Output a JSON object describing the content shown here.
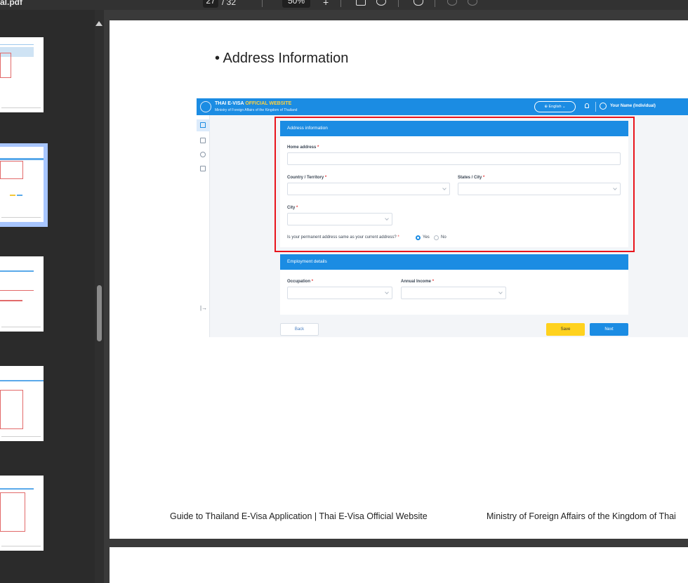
{
  "toolbar": {
    "file_name": "al.pdf",
    "current_page": "27",
    "total_pages": "/ 32",
    "zoom": "50%",
    "zoom_in": "+"
  },
  "document": {
    "section_heading": "• Address Information",
    "footer_left": "Guide to Thailand E-Visa Application | Thai E-Visa Official Website",
    "footer_right": "Ministry of Foreign Affairs of the Kingdom of Thai"
  },
  "screenshot": {
    "site_title_main": "THAI E-VISA ",
    "site_title_highlight": "OFFICIAL WEBSITE",
    "site_subtitle": "Ministry of Foreign Affairs of the Kingdom of Thailand",
    "language_button": "⊕ English ⌄",
    "user_name": "Your Name  (Individual)",
    "address_card": {
      "title": "Address information",
      "home_address_label": "Home address",
      "country_label": "Country / Territory",
      "states_label": "States / City",
      "city_label": "City",
      "permanent_question": "Is your permanent address same as your current address?",
      "required_mark": "*",
      "yes_label": "Yes",
      "no_label": "No",
      "selected_option": "Yes"
    },
    "employment_card": {
      "title": "Employment details",
      "occupation_label": "Occupation",
      "income_label": "Annual Income"
    },
    "buttons": {
      "back": "Back",
      "save": "Save",
      "next": "Next"
    },
    "logout_glyph": "|→",
    "colors": {
      "primary_blue": "#1b8ce3",
      "save_yellow": "#ffd21e",
      "highlight_red": "#e8141c"
    }
  }
}
